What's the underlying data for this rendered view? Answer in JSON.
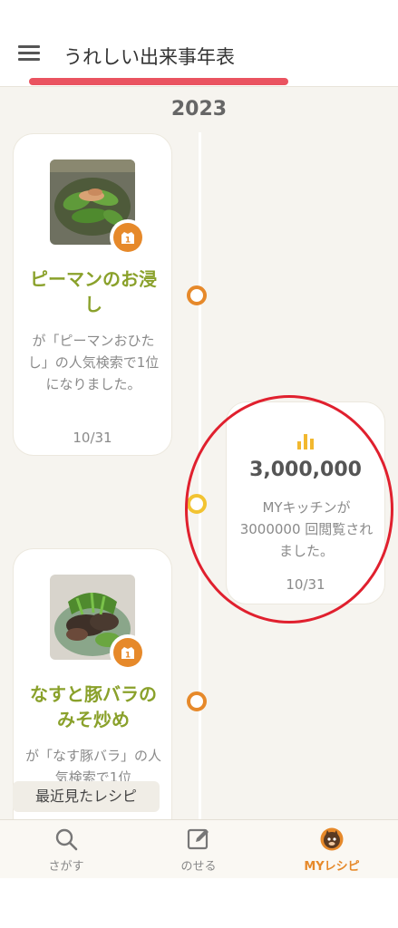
{
  "header": {
    "title": "うれしい出来事年表"
  },
  "timeline": {
    "year": "2023",
    "events": [
      {
        "type": "ranking",
        "rank": "1",
        "recipe_name": "ピーマンのお浸し",
        "description": "が「ピーマンおひたし」の人気検索で1位になりました。",
        "date": "10/31"
      },
      {
        "type": "views",
        "views": "3,000,000",
        "description": "MYキッチンが3000000 回閲覧されました。",
        "date": "10/31"
      },
      {
        "type": "ranking",
        "rank": "1",
        "recipe_name": "なすと豚バラのみそ炒め",
        "description": "が「なす豚バラ」の人気検索で1位"
      }
    ]
  },
  "recent_recipes_label": "最近見たレシピ",
  "bottom_nav": {
    "items": [
      {
        "label": "さがす",
        "icon": "search-icon"
      },
      {
        "label": "のせる",
        "icon": "edit-icon"
      },
      {
        "label": "MYレシピ",
        "icon": "my-recipe-icon",
        "active": true
      }
    ]
  },
  "colors": {
    "accent": "#e6892a",
    "recipe_title": "#8aa12b",
    "views_dot": "#f2c331",
    "annotation": "#e0202e"
  }
}
